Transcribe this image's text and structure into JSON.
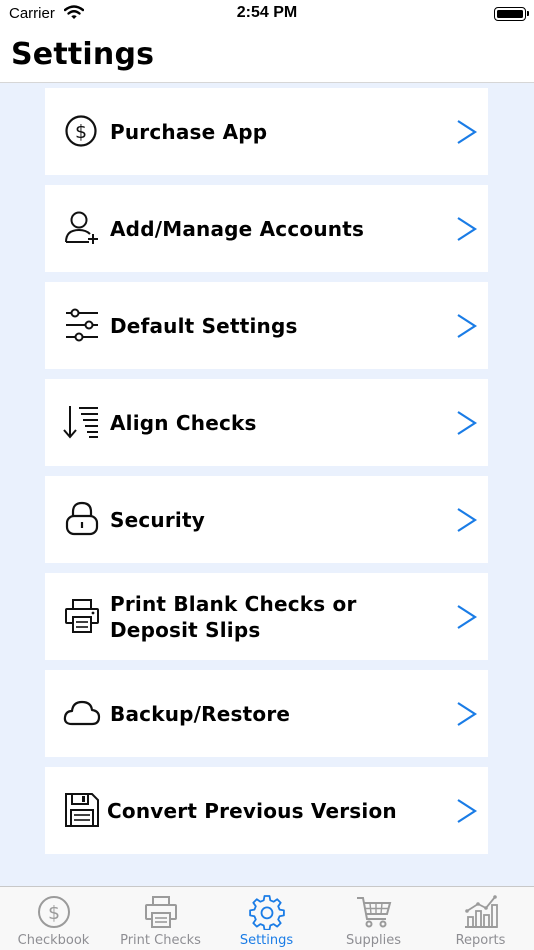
{
  "status_bar": {
    "carrier": "Carrier",
    "time": "2:54 PM"
  },
  "header": {
    "title": "Settings"
  },
  "colors": {
    "accent": "#1a7ce6",
    "content_bg": "#eaf1fd",
    "tab_inactive": "#8e8e93"
  },
  "settings_items": [
    {
      "label": "Purchase App",
      "icon": "dollar-circle-icon"
    },
    {
      "label": "Add/Manage Accounts",
      "icon": "add-user-icon"
    },
    {
      "label": "Default Settings",
      "icon": "sliders-icon"
    },
    {
      "label": "Align Checks",
      "icon": "align-list-icon"
    },
    {
      "label": "Security",
      "icon": "lock-icon"
    },
    {
      "label_line1": "Print Blank Checks or",
      "label_line2": "Deposit Slips",
      "icon": "printer-icon"
    },
    {
      "label": "Backup/Restore",
      "icon": "cloud-icon"
    },
    {
      "label": "Convert Previous Version",
      "icon": "floppy-disk-icon"
    }
  ],
  "tabs": [
    {
      "label": "Checkbook",
      "icon": "dollar-circle-icon",
      "active": false
    },
    {
      "label": "Print Checks",
      "icon": "printer-icon",
      "active": false
    },
    {
      "label": "Settings",
      "icon": "gear-icon",
      "active": true
    },
    {
      "label": "Supplies",
      "icon": "cart-icon",
      "active": false
    },
    {
      "label": "Reports",
      "icon": "chart-icon",
      "active": false
    }
  ]
}
